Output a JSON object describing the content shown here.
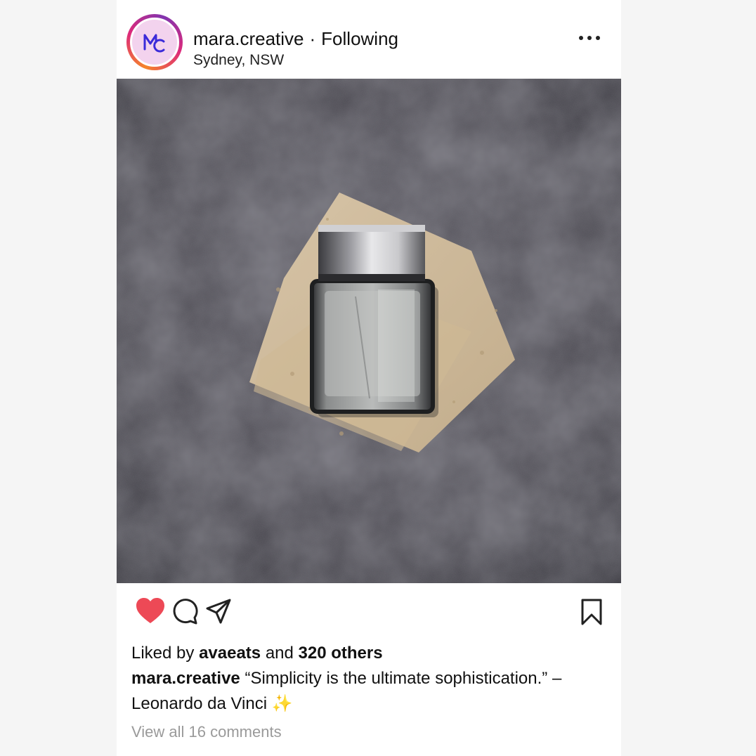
{
  "post": {
    "username": "mara.creative",
    "separator": "·",
    "follow_status": "Following",
    "location": "Sydney, NSW",
    "avatar_initials": "MC"
  },
  "engagement": {
    "liked_by_prefix": "Liked by",
    "liked_by_user": "avaeats",
    "liked_by_and": "and",
    "others": "320 others",
    "liked": true
  },
  "caption": {
    "author": "mara.creative",
    "text": "“Simplicity is the ultimate sophistication.” – Leonardo da Vinci",
    "emoji": "✨"
  },
  "comments_link": "View all 16 comments",
  "colors": {
    "like": "#ed4956",
    "avatar_bg": "#f3d3ee",
    "logo": "#3b2bd9",
    "muted": "#9a9a9a"
  },
  "icons": [
    "more-icon",
    "heart-icon",
    "comment-icon",
    "share-icon",
    "bookmark-icon"
  ]
}
